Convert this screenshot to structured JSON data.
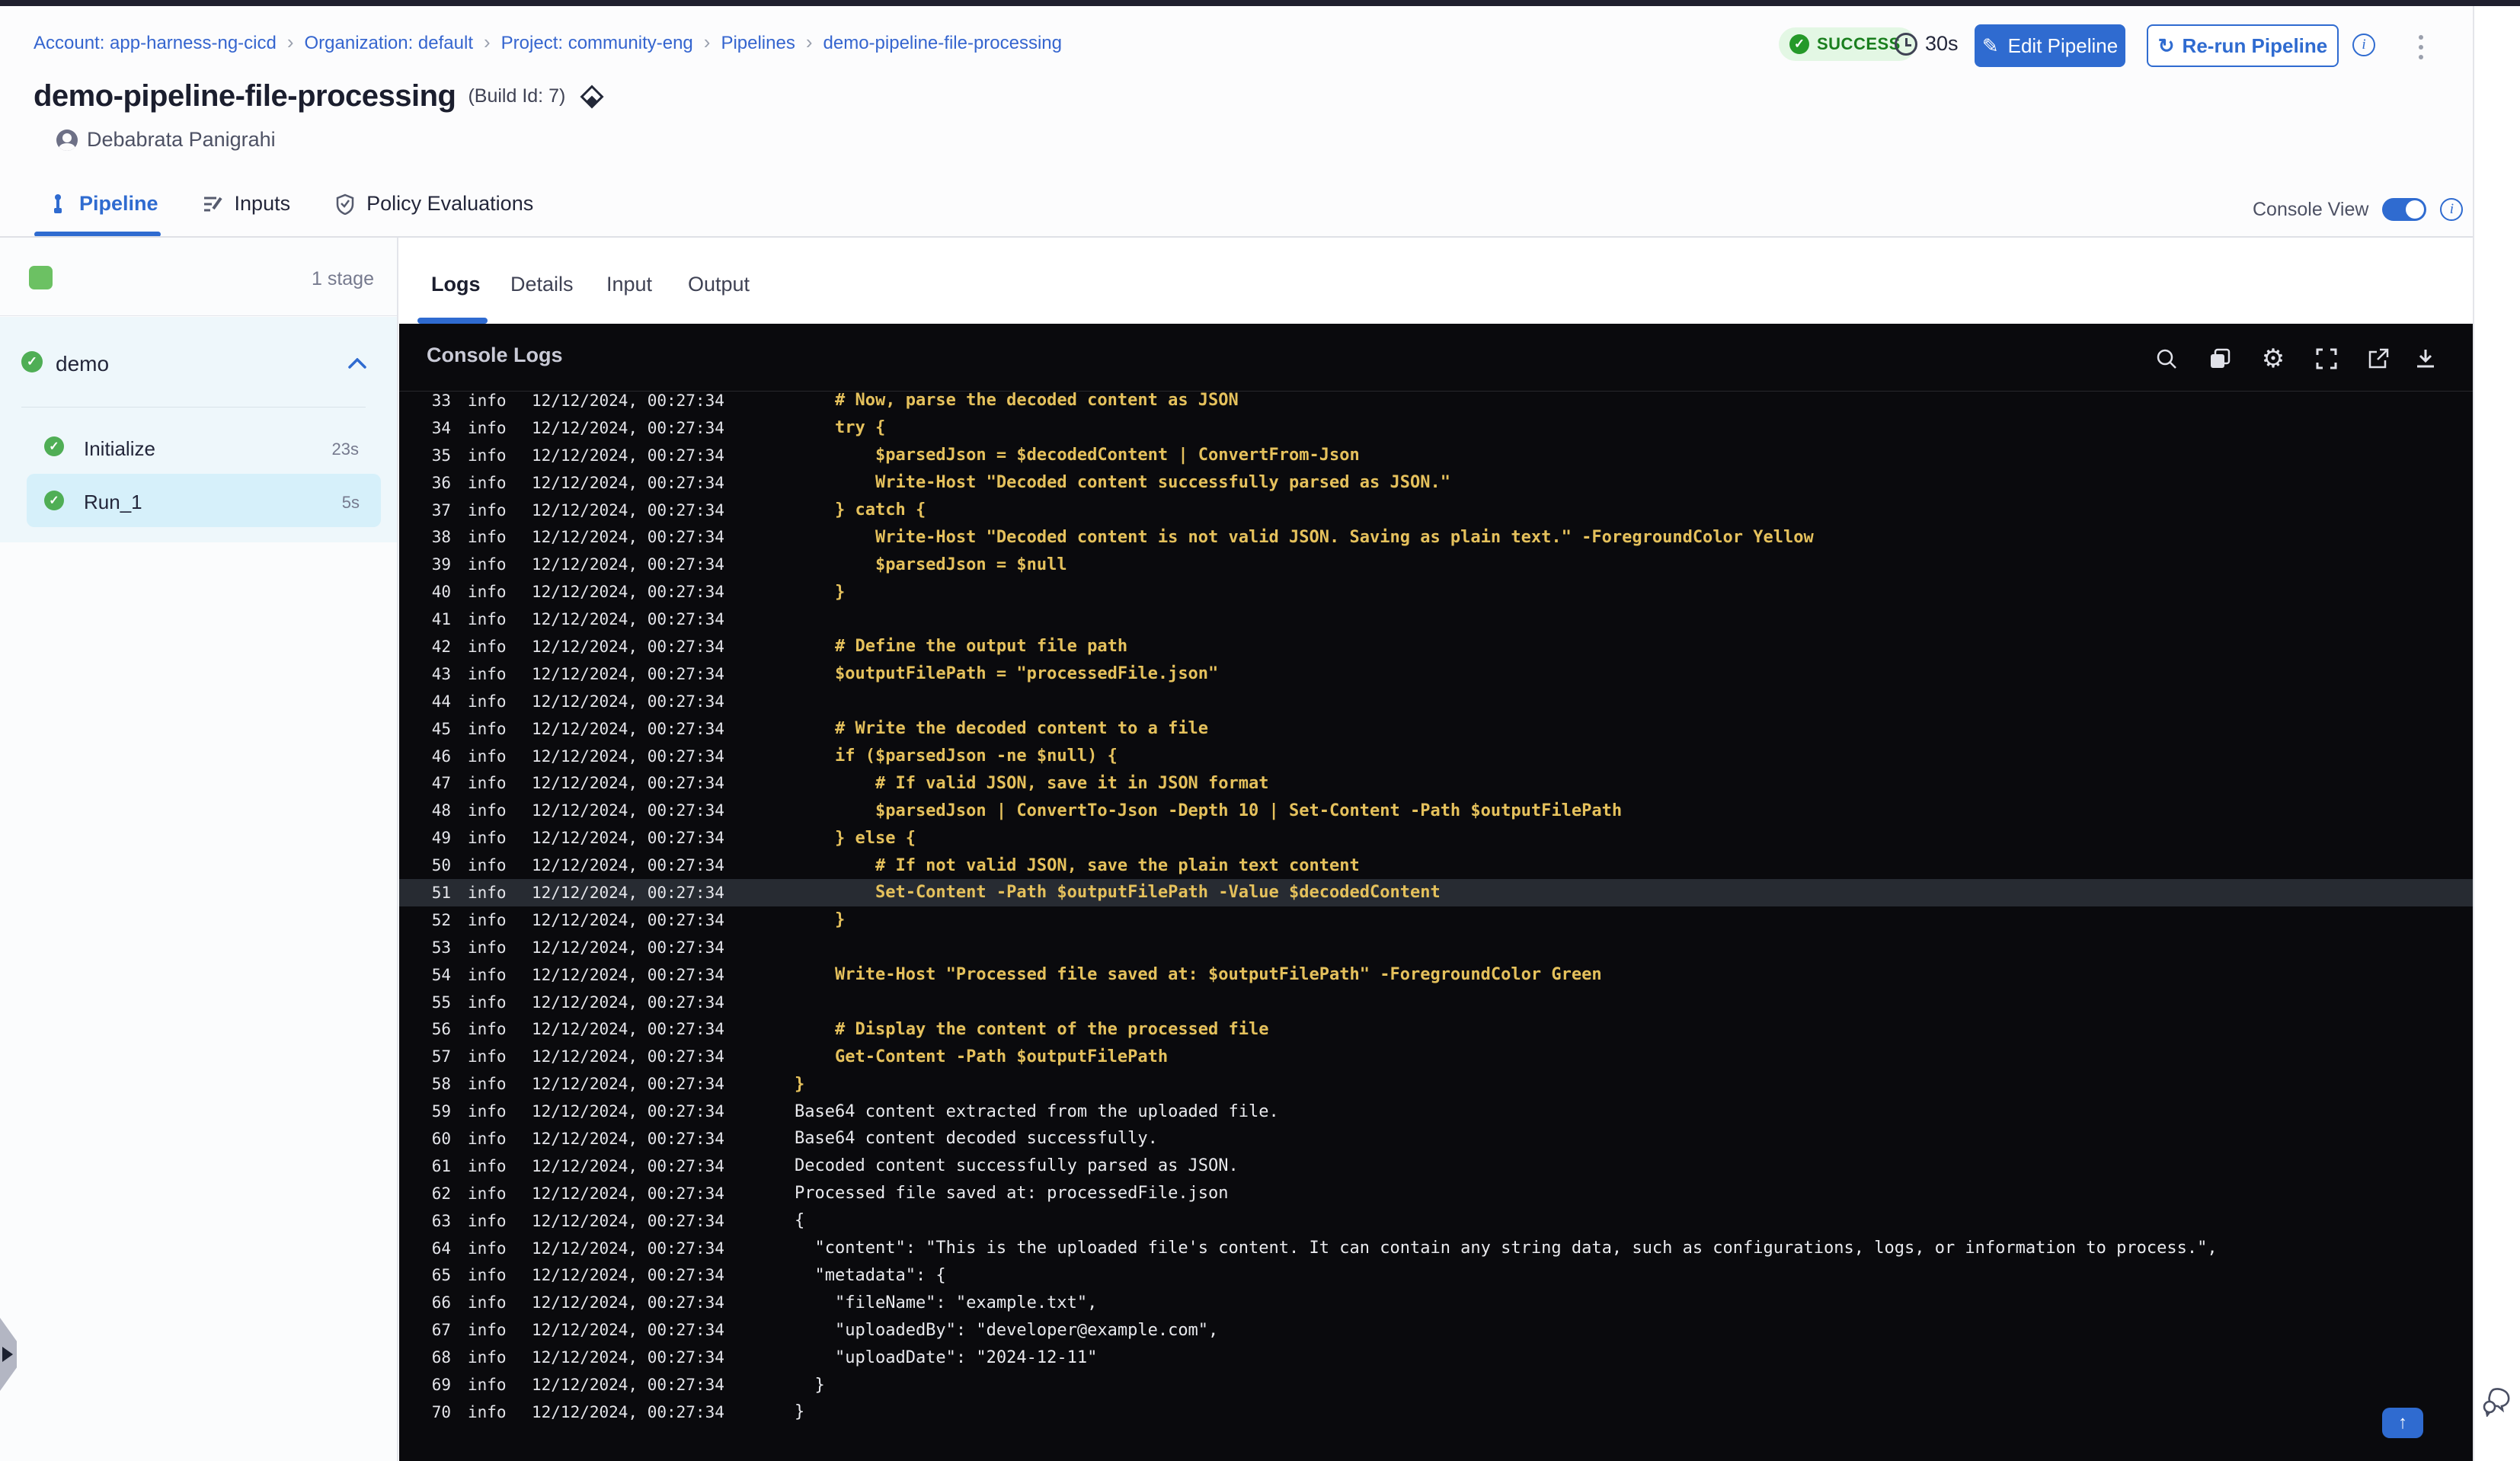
{
  "topbar": {
    "breadcrumbs": [
      "Account: app-harness-ng-cicd",
      "Organization: default",
      "Project: community-eng",
      "Pipelines",
      "demo-pipeline-file-processing"
    ],
    "status_label": "SUCCESS",
    "duration": "30s",
    "edit_button": "Edit Pipeline",
    "rerun_button": "Re-run Pipeline"
  },
  "header": {
    "title": "demo-pipeline-file-processing",
    "build_id": "(Build Id: 7)",
    "author": "Debabrata Panigrahi"
  },
  "nav_tabs": {
    "pipeline": "Pipeline",
    "inputs": "Inputs",
    "policy": "Policy Evaluations",
    "console_view_label": "Console View"
  },
  "sidebar": {
    "stage_count": "1 stage",
    "stage_name": "demo",
    "steps": [
      {
        "name": "Initialize",
        "duration": "23s"
      },
      {
        "name": "Run_1",
        "duration": "5s"
      }
    ]
  },
  "log_tabs": {
    "logs": "Logs",
    "details": "Details",
    "input": "Input",
    "output": "Output"
  },
  "console": {
    "title": "Console Logs",
    "icons": [
      "search",
      "copy",
      "settings",
      "fullscreen",
      "open-in-new",
      "download"
    ],
    "level": "info",
    "timestamp": "12/12/2024, 00:27:34",
    "highlighted_line": 51,
    "lines": [
      {
        "n": 33,
        "kind": "code",
        "text": "    # Now, parse the decoded content as JSON"
      },
      {
        "n": 34,
        "kind": "code",
        "text": "    try {"
      },
      {
        "n": 35,
        "kind": "code",
        "text": "        $parsedJson = $decodedContent | ConvertFrom-Json"
      },
      {
        "n": 36,
        "kind": "code",
        "text": "        Write-Host \"Decoded content successfully parsed as JSON.\""
      },
      {
        "n": 37,
        "kind": "code",
        "text": "    } catch {"
      },
      {
        "n": 38,
        "kind": "code",
        "text": "        Write-Host \"Decoded content is not valid JSON. Saving as plain text.\" -ForegroundColor Yellow"
      },
      {
        "n": 39,
        "kind": "code",
        "text": "        $parsedJson = $null"
      },
      {
        "n": 40,
        "kind": "code",
        "text": "    }"
      },
      {
        "n": 41,
        "kind": "code",
        "text": ""
      },
      {
        "n": 42,
        "kind": "code",
        "text": "    # Define the output file path"
      },
      {
        "n": 43,
        "kind": "code",
        "text": "    $outputFilePath = \"processedFile.json\""
      },
      {
        "n": 44,
        "kind": "code",
        "text": ""
      },
      {
        "n": 45,
        "kind": "code",
        "text": "    # Write the decoded content to a file"
      },
      {
        "n": 46,
        "kind": "code",
        "text": "    if ($parsedJson -ne $null) {"
      },
      {
        "n": 47,
        "kind": "code",
        "text": "        # If valid JSON, save it in JSON format"
      },
      {
        "n": 48,
        "kind": "code",
        "text": "        $parsedJson | ConvertTo-Json -Depth 10 | Set-Content -Path $outputFilePath"
      },
      {
        "n": 49,
        "kind": "code",
        "text": "    } else {"
      },
      {
        "n": 50,
        "kind": "code",
        "text": "        # If not valid JSON, save the plain text content"
      },
      {
        "n": 51,
        "kind": "code",
        "text": "        Set-Content -Path $outputFilePath -Value $decodedContent"
      },
      {
        "n": 52,
        "kind": "code",
        "text": "    }"
      },
      {
        "n": 53,
        "kind": "code",
        "text": ""
      },
      {
        "n": 54,
        "kind": "code",
        "text": "    Write-Host \"Processed file saved at: $outputFilePath\" -ForegroundColor Green"
      },
      {
        "n": 55,
        "kind": "code",
        "text": ""
      },
      {
        "n": 56,
        "kind": "code",
        "text": "    # Display the content of the processed file"
      },
      {
        "n": 57,
        "kind": "code",
        "text": "    Get-Content -Path $outputFilePath"
      },
      {
        "n": 58,
        "kind": "code",
        "text": "}"
      },
      {
        "n": 59,
        "kind": "out",
        "text": "Base64 content extracted from the uploaded file."
      },
      {
        "n": 60,
        "kind": "out",
        "text": "Base64 content decoded successfully."
      },
      {
        "n": 61,
        "kind": "out",
        "text": "Decoded content successfully parsed as JSON."
      },
      {
        "n": 62,
        "kind": "out",
        "text": "Processed file saved at: processedFile.json"
      },
      {
        "n": 63,
        "kind": "out",
        "text": "{"
      },
      {
        "n": 64,
        "kind": "out",
        "text": "  \"content\": \"This is the uploaded file's content. It can contain any string data, such as configurations, logs, or information to process.\","
      },
      {
        "n": 65,
        "kind": "out",
        "text": "  \"metadata\": {"
      },
      {
        "n": 66,
        "kind": "out",
        "text": "    \"fileName\": \"example.txt\","
      },
      {
        "n": 67,
        "kind": "out",
        "text": "    \"uploadedBy\": \"developer@example.com\","
      },
      {
        "n": 68,
        "kind": "out",
        "text": "    \"uploadDate\": \"2024-12-11\""
      },
      {
        "n": 69,
        "kind": "out",
        "text": "  }"
      },
      {
        "n": 70,
        "kind": "out",
        "text": "}"
      }
    ]
  },
  "colors": {
    "accent_blue": "#2f6bd0",
    "link_blue": "#3565cf",
    "success_green": "#4fae55",
    "badge_bg": "#e3f7e4",
    "badge_text": "#1a7f1e",
    "code_yellow": "#e5c15c",
    "console_bg": "#0a0a0d",
    "selected_step_bg": "#d6f0fa",
    "stage_group_bg": "#eef7fb"
  }
}
